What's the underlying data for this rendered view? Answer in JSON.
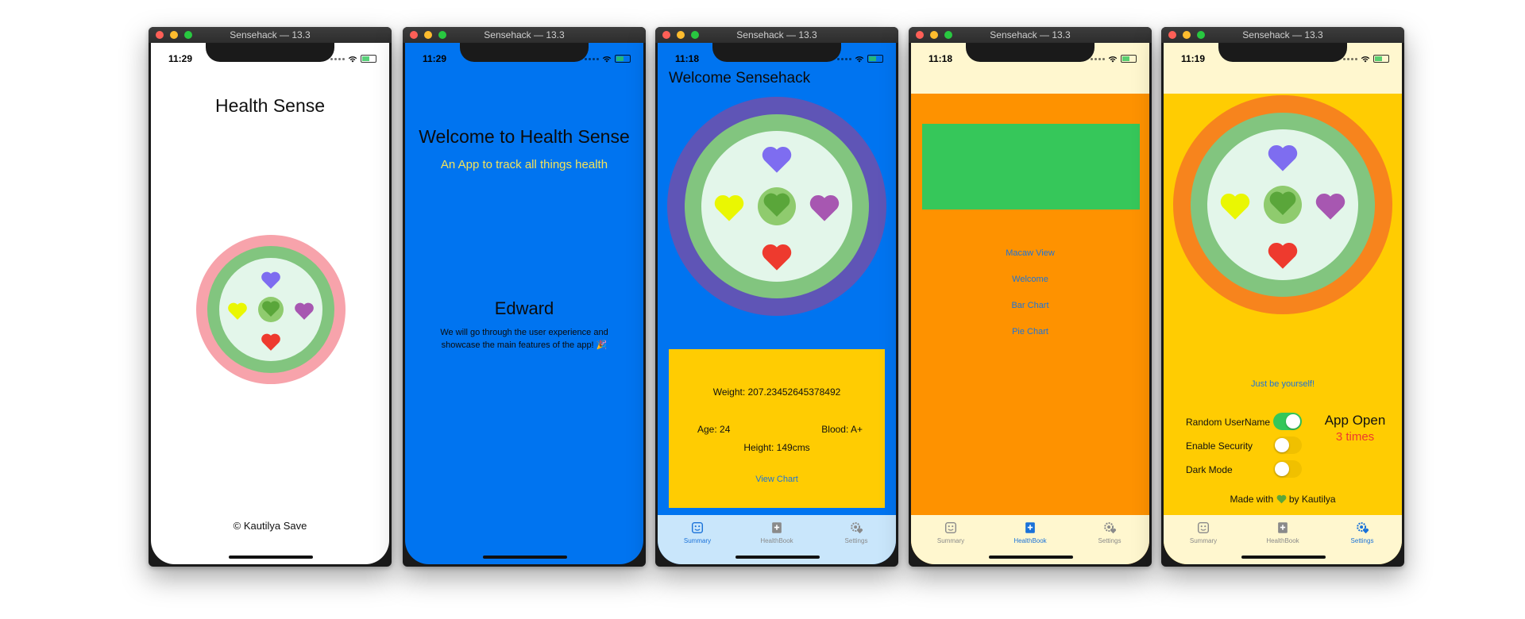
{
  "windows": [
    {
      "title": "Sensehack — 13.3",
      "time": "11:29"
    },
    {
      "title": "Sensehack — 13.3",
      "time": "11:29"
    },
    {
      "title": "Sensehack — 13.3",
      "time": "11:18"
    },
    {
      "title": "Sensehack — 13.3",
      "time": "11:18"
    },
    {
      "title": "Sensehack — 13.3",
      "time": "11:19"
    }
  ],
  "splash": {
    "title": "Health Sense",
    "footer": "© Kautilya Save"
  },
  "onboarding": {
    "title": "Welcome to Health Sense",
    "subtitle": "An App to track all things health",
    "name": "Edward",
    "description": "We will go through the user experience and showcase the main features of the app! 🎉"
  },
  "summary": {
    "welcome": "Welcome Sensehack",
    "weight": "Weight: 207.23452645378492",
    "age": "Age: 24",
    "blood": "Blood: A+",
    "height": "Height: 149cms",
    "view_chart": "View Chart"
  },
  "healthbook": {
    "items": [
      "Macaw View",
      "Welcome",
      "Bar Chart",
      "Pie Chart"
    ]
  },
  "settings": {
    "tagline": "Just be yourself!",
    "random_username": "Random UserName",
    "enable_security": "Enable Security",
    "dark_mode": "Dark Mode",
    "toggles": {
      "random_username": true,
      "enable_security": false,
      "dark_mode": false
    },
    "app_open_label": "App Open",
    "app_open_count": "3 times",
    "made_with_prefix": "Made with",
    "made_with_suffix": "by Kautilya"
  },
  "tabs": [
    "Summary",
    "HealthBook",
    "Settings"
  ],
  "colors": {
    "ios_blue": "#0074f0",
    "orange": "#fe9200",
    "yellow": "#ffcc02",
    "green_card": "#36c75a",
    "tabbar_light_blue": "#c9e6fb",
    "tabbar_cream": "#fff7cf",
    "heart_purple": "#7e6df0",
    "heart_yellow": "#eaf702",
    "heart_violet": "#a757b1",
    "heart_red": "#ee3a2e",
    "heart_green": "#5aa63a"
  }
}
